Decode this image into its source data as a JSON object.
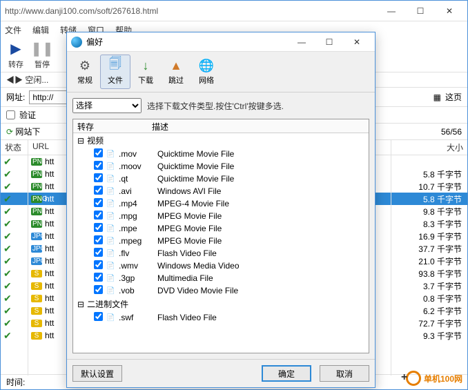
{
  "main": {
    "url": "http://www.danji100.com/soft/267618.html",
    "menu": [
      "文件",
      "编辑",
      "转储",
      "窗口",
      "帮助"
    ],
    "toolbar": [
      {
        "label": "转存",
        "color": "#1a4aa0",
        "glyph": "▶"
      },
      {
        "label": "暂停",
        "color": "#aaa",
        "glyph": "❚❚"
      }
    ],
    "status_idle": "◀▶ 空闲...",
    "addr_label": "网址:",
    "addr_value": "http://",
    "verify_label": "验证",
    "site_label": "网站下",
    "refresh_icon": "⟳",
    "this_page": "这页",
    "page_icon": "▦",
    "page_count": "56/56",
    "columns": {
      "status": "状态",
      "url": "URL",
      "size": "大小"
    },
    "rows": [
      {
        "type": "png",
        "url": "htt",
        "size": ""
      },
      {
        "type": "png",
        "url": "htt",
        "size": "5.8 千字节"
      },
      {
        "type": "png",
        "url": "htt",
        "size": "10.7 千字节"
      },
      {
        "type": "png",
        "url": "htt",
        "size": "5.8 千字节",
        "selected": true
      },
      {
        "type": "png",
        "url": "htt",
        "size": "9.8 千字节"
      },
      {
        "type": "png",
        "url": "htt",
        "size": "8.3 千字节"
      },
      {
        "type": "jpg",
        "url": "htt",
        "size": "16.9 千字节"
      },
      {
        "type": "jpg",
        "url": "htt",
        "size": "37.7 千字节"
      },
      {
        "type": "jpg",
        "url": "htt",
        "size": "21.0 千字节"
      },
      {
        "type": "s",
        "url": "htt",
        "size": "93.8 千字节"
      },
      {
        "type": "s",
        "url": "htt",
        "size": "3.7 千字节"
      },
      {
        "type": "s",
        "url": "htt",
        "size": "0.8 千字节"
      },
      {
        "type": "s",
        "url": "htt",
        "size": "6.2 千字节"
      },
      {
        "type": "s",
        "url": "htt",
        "size": "72.7 千字节"
      },
      {
        "type": "s",
        "url": "htt",
        "size": "9.3 千字节"
      }
    ],
    "time_label": "时间:"
  },
  "pref": {
    "title": "偏好",
    "tabs": [
      {
        "label": "常规",
        "icon": "⚙",
        "color": "#555"
      },
      {
        "label": "文件",
        "icon": "🗐",
        "color": "#2d89d6",
        "active": true
      },
      {
        "label": "下载",
        "icon": "↓",
        "color": "#2a8a2a"
      },
      {
        "label": "跳过",
        "icon": "▲",
        "color": "#d07a2a"
      },
      {
        "label": "网络",
        "icon": "🌐",
        "color": "#2d89d6"
      }
    ],
    "select_label": "选择",
    "hint": "选择下载文件类型.按住'Ctrl'按键多选.",
    "col1": "转存",
    "col2": "描述",
    "group_video": "视频",
    "group_binary": "二进制文件",
    "exts": [
      {
        "ext": ".mov",
        "desc": "Quicktime Movie File"
      },
      {
        "ext": ".moov",
        "desc": "Quicktime Movie File"
      },
      {
        "ext": ".qt",
        "desc": "Quicktime Movie File"
      },
      {
        "ext": ".avi",
        "desc": "Windows AVI File"
      },
      {
        "ext": ".mp4",
        "desc": "MPEG-4 Movie File"
      },
      {
        "ext": ".mpg",
        "desc": "MPEG Movie File"
      },
      {
        "ext": ".mpe",
        "desc": "MPEG Movie File"
      },
      {
        "ext": ".mpeg",
        "desc": "MPEG Movie File"
      },
      {
        "ext": ".flv",
        "desc": "Flash Video File"
      },
      {
        "ext": ".wmv",
        "desc": "Windows Media Video"
      },
      {
        "ext": ".3gp",
        "desc": "Multimedia File"
      },
      {
        "ext": ".vob",
        "desc": "DVD Video Movie File"
      }
    ],
    "binary_exts": [
      {
        "ext": ".swf",
        "desc": "Flash Video File"
      }
    ],
    "btn_default": "默认设置",
    "btn_ok": "确定",
    "btn_cancel": "取消"
  },
  "watermark": {
    "text": "单机100网"
  }
}
